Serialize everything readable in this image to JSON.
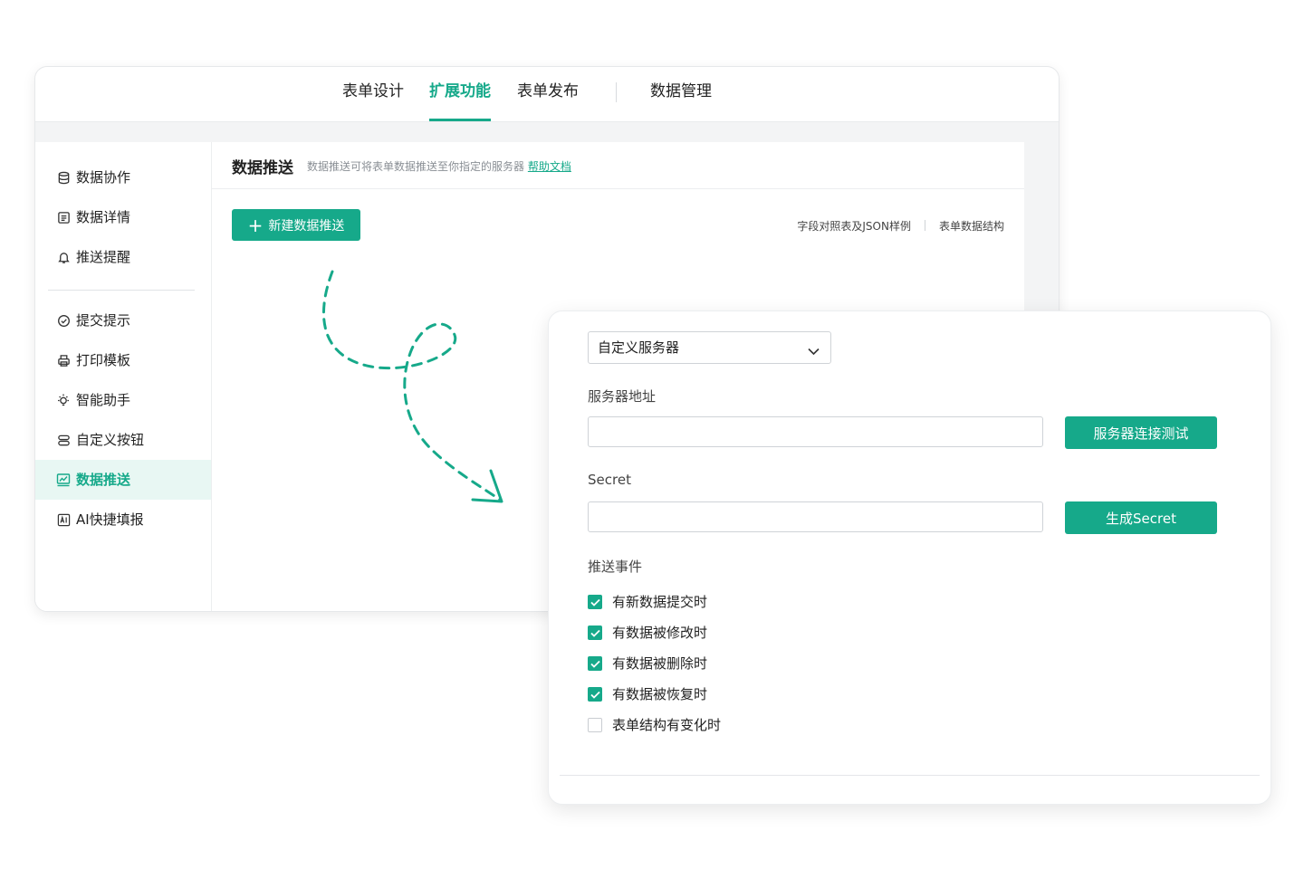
{
  "topnav": {
    "tabs": [
      {
        "label": "表单设计"
      },
      {
        "label": "扩展功能"
      },
      {
        "label": "表单发布"
      },
      {
        "label": "数据管理"
      }
    ],
    "active_tab": "扩展功能"
  },
  "sidebar": {
    "items": [
      {
        "label": "数据协作",
        "icon": "database-icon"
      },
      {
        "label": "数据详情",
        "icon": "document-icon"
      },
      {
        "label": "推送提醒",
        "icon": "bell-icon"
      },
      {
        "label": "提交提示",
        "icon": "check-circle-icon"
      },
      {
        "label": "打印模板",
        "icon": "printer-icon"
      },
      {
        "label": "智能助手",
        "icon": "lightbulb-icon"
      },
      {
        "label": "自定义按钮",
        "icon": "button-stack-icon"
      },
      {
        "label": "数据推送",
        "icon": "chart-line-icon"
      },
      {
        "label": "AI快捷填报",
        "icon": "ai-icon"
      }
    ],
    "active_item": "数据推送"
  },
  "panel": {
    "title": "数据推送",
    "description": "数据推送可将表单数据推送至你指定的服务器",
    "help_link": "帮助文档",
    "new_button": "新建数据推送",
    "links": [
      "字段对照表及JSON样例",
      "表单数据结构"
    ]
  },
  "card": {
    "server_type": "自定义服务器",
    "server_address_label": "服务器地址",
    "server_address_value": "",
    "test_button": "服务器连接测试",
    "secret_label": "Secret",
    "secret_value": "",
    "generate_button": "生成Secret",
    "events_label": "推送事件",
    "events": [
      {
        "label": "有新数据提交时",
        "checked": true
      },
      {
        "label": "有数据被修改时",
        "checked": true
      },
      {
        "label": "有数据被删除时",
        "checked": true
      },
      {
        "label": "有数据被恢复时",
        "checked": true
      },
      {
        "label": "表单结构有变化时",
        "checked": false
      }
    ]
  },
  "colors": {
    "accent": "#16a98a",
    "active_bg": "#e8f7f3"
  }
}
